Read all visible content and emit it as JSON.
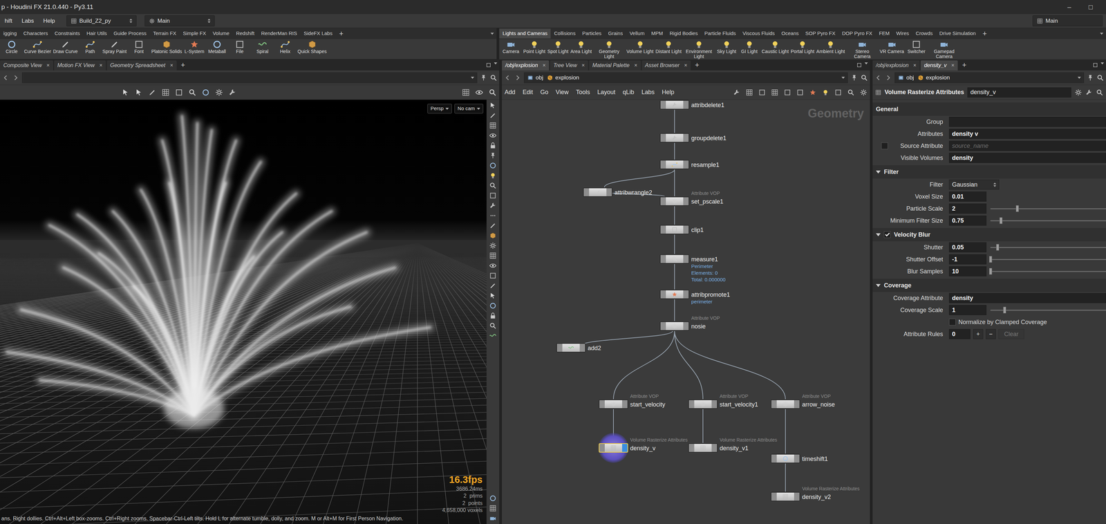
{
  "window": {
    "title": "p - Houdini FX 21.0.440 - Py3.11",
    "controls": [
      "–",
      "□"
    ]
  },
  "menubar": {
    "items": [
      "hift",
      "Labs",
      "Help"
    ],
    "desktops": [
      "Build_Z2_py",
      "Main"
    ],
    "right": "Main"
  },
  "shelves": [
    {
      "tabs": [
        {
          "label": "igging",
          "selected": false
        },
        {
          "label": "Characters",
          "selected": false
        },
        {
          "label": "Constraints",
          "selected": false
        },
        {
          "label": "Hair Utils",
          "selected": false
        },
        {
          "label": "Guide Process",
          "selected": false
        },
        {
          "label": "Terrain FX",
          "selected": false
        },
        {
          "label": "Simple FX",
          "selected": false
        },
        {
          "label": "Volume",
          "selected": false
        },
        {
          "label": "Redshift",
          "selected": false
        },
        {
          "label": "RenderMan RIS",
          "selected": false
        },
        {
          "label": "SideFX Labs",
          "selected": false
        }
      ],
      "add": "+",
      "tools": [
        "Circle",
        "Curve Bezier",
        "Draw Curve",
        "Path",
        "Spray Paint",
        "Font",
        "Platonic Solids",
        "L-System",
        "Metaball",
        "File",
        "Spiral",
        "Helix",
        "Quick Shapes"
      ]
    },
    {
      "tabs": [
        {
          "label": "Lights and Cameras",
          "selected": true
        },
        {
          "label": "Collisions",
          "selected": false
        },
        {
          "label": "Particles",
          "selected": false
        },
        {
          "label": "Grains",
          "selected": false
        },
        {
          "label": "Vellum",
          "selected": false
        },
        {
          "label": "MPM",
          "selected": false
        },
        {
          "label": "Rigid Bodies",
          "selected": false
        },
        {
          "label": "Particle Fluids",
          "selected": false
        },
        {
          "label": "Viscous Fluids",
          "selected": false
        },
        {
          "label": "Oceans",
          "selected": false
        },
        {
          "label": "SOP Pyro FX",
          "selected": false
        },
        {
          "label": "DOP Pyro FX",
          "selected": false
        },
        {
          "label": "FEM",
          "selected": false
        },
        {
          "label": "Wires",
          "selected": false
        },
        {
          "label": "Crowds",
          "selected": false
        },
        {
          "label": "Drive Simulation",
          "selected": false
        }
      ],
      "add": "+",
      "tools": [
        "Camera",
        "Point Light",
        "Spot Light",
        "Area Light",
        "Geometry Light",
        "Volume Light",
        "Distant Light",
        "Environment Light",
        "Sky Light",
        "GI Light",
        "Caustic Light",
        "Portal Light",
        "Ambient Light",
        "Stereo Camera",
        "VR Camera",
        "Switcher",
        "Gamepad Camera"
      ]
    }
  ],
  "viewer": {
    "tabs": [
      {
        "label": "Composite View",
        "selected": false
      },
      {
        "label": "Motion FX View",
        "selected": false
      },
      {
        "label": "Geometry Spreadsheet",
        "selected": false
      }
    ],
    "close": "×",
    "add": "+",
    "camera": "Persp",
    "cam": "No cam",
    "fps": "16.3fps",
    "stats": [
      "3686.24ms",
      "2  prims",
      "2  points",
      "4,658,000 voxels"
    ],
    "status": "ans. Right dollies. Ctrl+Alt+Left box-zooms. Ctrl+Right zooms. Spacebar-Ctrl-Left tilts. Hold L for alternate tumble, dolly, and zoom. M or Alt+M for First Person Navigation."
  },
  "network": {
    "tabs": [
      {
        "label": "/obj/explosion",
        "selected": true
      },
      {
        "label": "Tree View",
        "selected": false
      },
      {
        "label": "Material Palette",
        "selected": false
      },
      {
        "label": "Asset Browser",
        "selected": false
      }
    ],
    "close": "×",
    "add": "+",
    "path": [
      "obj",
      "explosion"
    ],
    "menu": [
      "Add",
      "Edit",
      "Go",
      "View",
      "Tools",
      "Layout",
      "qLib",
      "Labs",
      "Help"
    ],
    "context": "Geometry",
    "nodes": [
      {
        "name": "attribdelete1",
        "type": "",
        "info": [],
        "selected": false,
        "display": false
      },
      {
        "name": "groupdelete1",
        "type": "",
        "info": [],
        "selected": false,
        "display": false
      },
      {
        "name": "resample1",
        "type": "",
        "info": [],
        "selected": false,
        "display": false
      },
      {
        "name": "attribwrangle2",
        "type": "",
        "info": [],
        "selected": false,
        "display": false
      },
      {
        "name": "set_pscale1",
        "type": "Attribute VOP",
        "info": [],
        "selected": false,
        "display": false
      },
      {
        "name": "clip1",
        "type": "",
        "info": [],
        "selected": false,
        "display": false
      },
      {
        "name": "measure1",
        "type": "",
        "info": [
          "Perimeter",
          "Elements: 0",
          "Total: 0.000000"
        ],
        "selected": false,
        "display": false
      },
      {
        "name": "attribpromote1",
        "type": "",
        "info": [
          "perimeter"
        ],
        "selected": false,
        "display": false
      },
      {
        "name": "nosie",
        "type": "Attribute VOP",
        "info": [],
        "selected": false,
        "display": false
      },
      {
        "name": "add2",
        "type": "",
        "info": [],
        "selected": false,
        "display": false
      },
      {
        "name": "start_velocity",
        "type": "Attribute VOP",
        "info": [],
        "selected": false,
        "display": false
      },
      {
        "name": "start_velocity1",
        "type": "Attribute VOP",
        "info": [],
        "selected": false,
        "display": false
      },
      {
        "name": "arrow_noise",
        "type": "Attribute VOP",
        "info": [],
        "selected": false,
        "display": false
      },
      {
        "name": "density_v",
        "type": "Volume Rasterize Attributes",
        "info": [],
        "selected": true,
        "display": true
      },
      {
        "name": "density_v1",
        "type": "Volume Rasterize Attributes",
        "info": [],
        "selected": false,
        "display": false
      },
      {
        "name": "timeshift1",
        "type": "",
        "info": [],
        "selected": false,
        "display": false
      },
      {
        "name": "density_v2",
        "type": "Volume Rasterize Attributes",
        "info": [],
        "selected": false,
        "display": false
      }
    ]
  },
  "params": {
    "tabs": [
      {
        "label": "/obj/explosion",
        "selected": false
      },
      {
        "label": "density_v",
        "selected": true
      }
    ],
    "close": "×",
    "add": "+",
    "path": [
      "obj",
      "explosion"
    ],
    "node_type": "Volume Rasterize Attributes",
    "node_name": "density_v",
    "sections": [
      {
        "title": "General",
        "kind": "tab",
        "rows": [
          {
            "kind": "text",
            "label": "Group",
            "value": ""
          },
          {
            "kind": "text",
            "label": "Attributes",
            "value": "density v"
          },
          {
            "kind": "check-text",
            "label": "Source Attribute",
            "checked": false,
            "placeholder": "source_name"
          },
          {
            "kind": "text",
            "label": "Visible Volumes",
            "value": "density"
          }
        ]
      },
      {
        "title": "Filter",
        "kind": "fold",
        "expanded": true,
        "rows": [
          {
            "kind": "menu",
            "label": "Filter",
            "value": "Gaussian"
          },
          {
            "kind": "text",
            "label": "Voxel Size",
            "value": "0.01"
          },
          {
            "kind": "slider",
            "label": "Particle Scale",
            "value": "2",
            "level": 0.23
          },
          {
            "kind": "slider",
            "label": "Minimum Filter Size",
            "value": "0.75",
            "level": 0.09
          }
        ]
      },
      {
        "title": "Velocity Blur",
        "kind": "toggle-fold",
        "expanded": true,
        "checked": true,
        "rows": [
          {
            "kind": "slider",
            "label": "Shutter",
            "value": "0.05",
            "level": 0.06
          },
          {
            "kind": "slider",
            "label": "Shutter Offset",
            "value": "-1",
            "level": 0.0
          },
          {
            "kind": "slider",
            "label": "Blur Samples",
            "value": "10",
            "level": 0.0
          }
        ]
      },
      {
        "title": "Coverage",
        "kind": "fold",
        "expanded": true,
        "rows": [
          {
            "kind": "text",
            "label": "Coverage Attribute",
            "value": "density"
          },
          {
            "kind": "slider",
            "label": "Coverage Scale",
            "value": "1",
            "level": 0.12
          },
          {
            "kind": "check",
            "label": "Normalize by Clamped Coverage",
            "checked": false
          },
          {
            "kind": "multi",
            "label": "Attribute Rules",
            "value": "0",
            "buttons": [
              "+",
              "−"
            ],
            "clear": "Clear"
          }
        ]
      }
    ]
  }
}
